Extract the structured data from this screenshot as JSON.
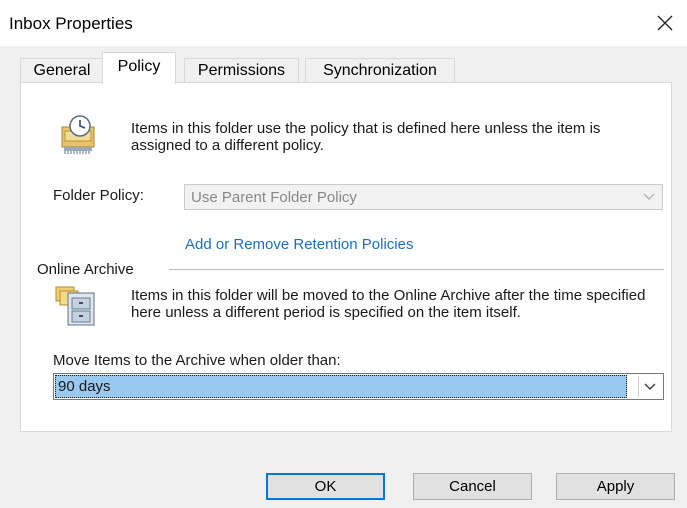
{
  "window": {
    "title": "Inbox Properties"
  },
  "tabs": [
    {
      "label": "General"
    },
    {
      "label": "Policy",
      "active": true
    },
    {
      "label": "Permissions"
    },
    {
      "label": "Synchronization"
    }
  ],
  "policy": {
    "icon": "policy-clock-icon",
    "description": "Items in this folder use the policy that is defined here unless the item is assigned to a different policy.",
    "folder_policy_label": "Folder Policy:",
    "folder_policy_value": "Use Parent Folder Policy",
    "link": "Add or Remove Retention Policies"
  },
  "archive": {
    "group_label": "Online Archive",
    "icon": "archive-cabinet-icon",
    "description": "Items in this folder will be moved to the Online Archive after the time specified here unless a different period is specified on the item itself.",
    "move_label": "Move Items to the Archive when older than:",
    "move_value": "90 days"
  },
  "buttons": {
    "ok": "OK",
    "cancel": "Cancel",
    "apply": "Apply"
  },
  "colors": {
    "link": "#1a6fc9",
    "selection": "#99c9ef",
    "default_button_border": "#0078d7"
  }
}
